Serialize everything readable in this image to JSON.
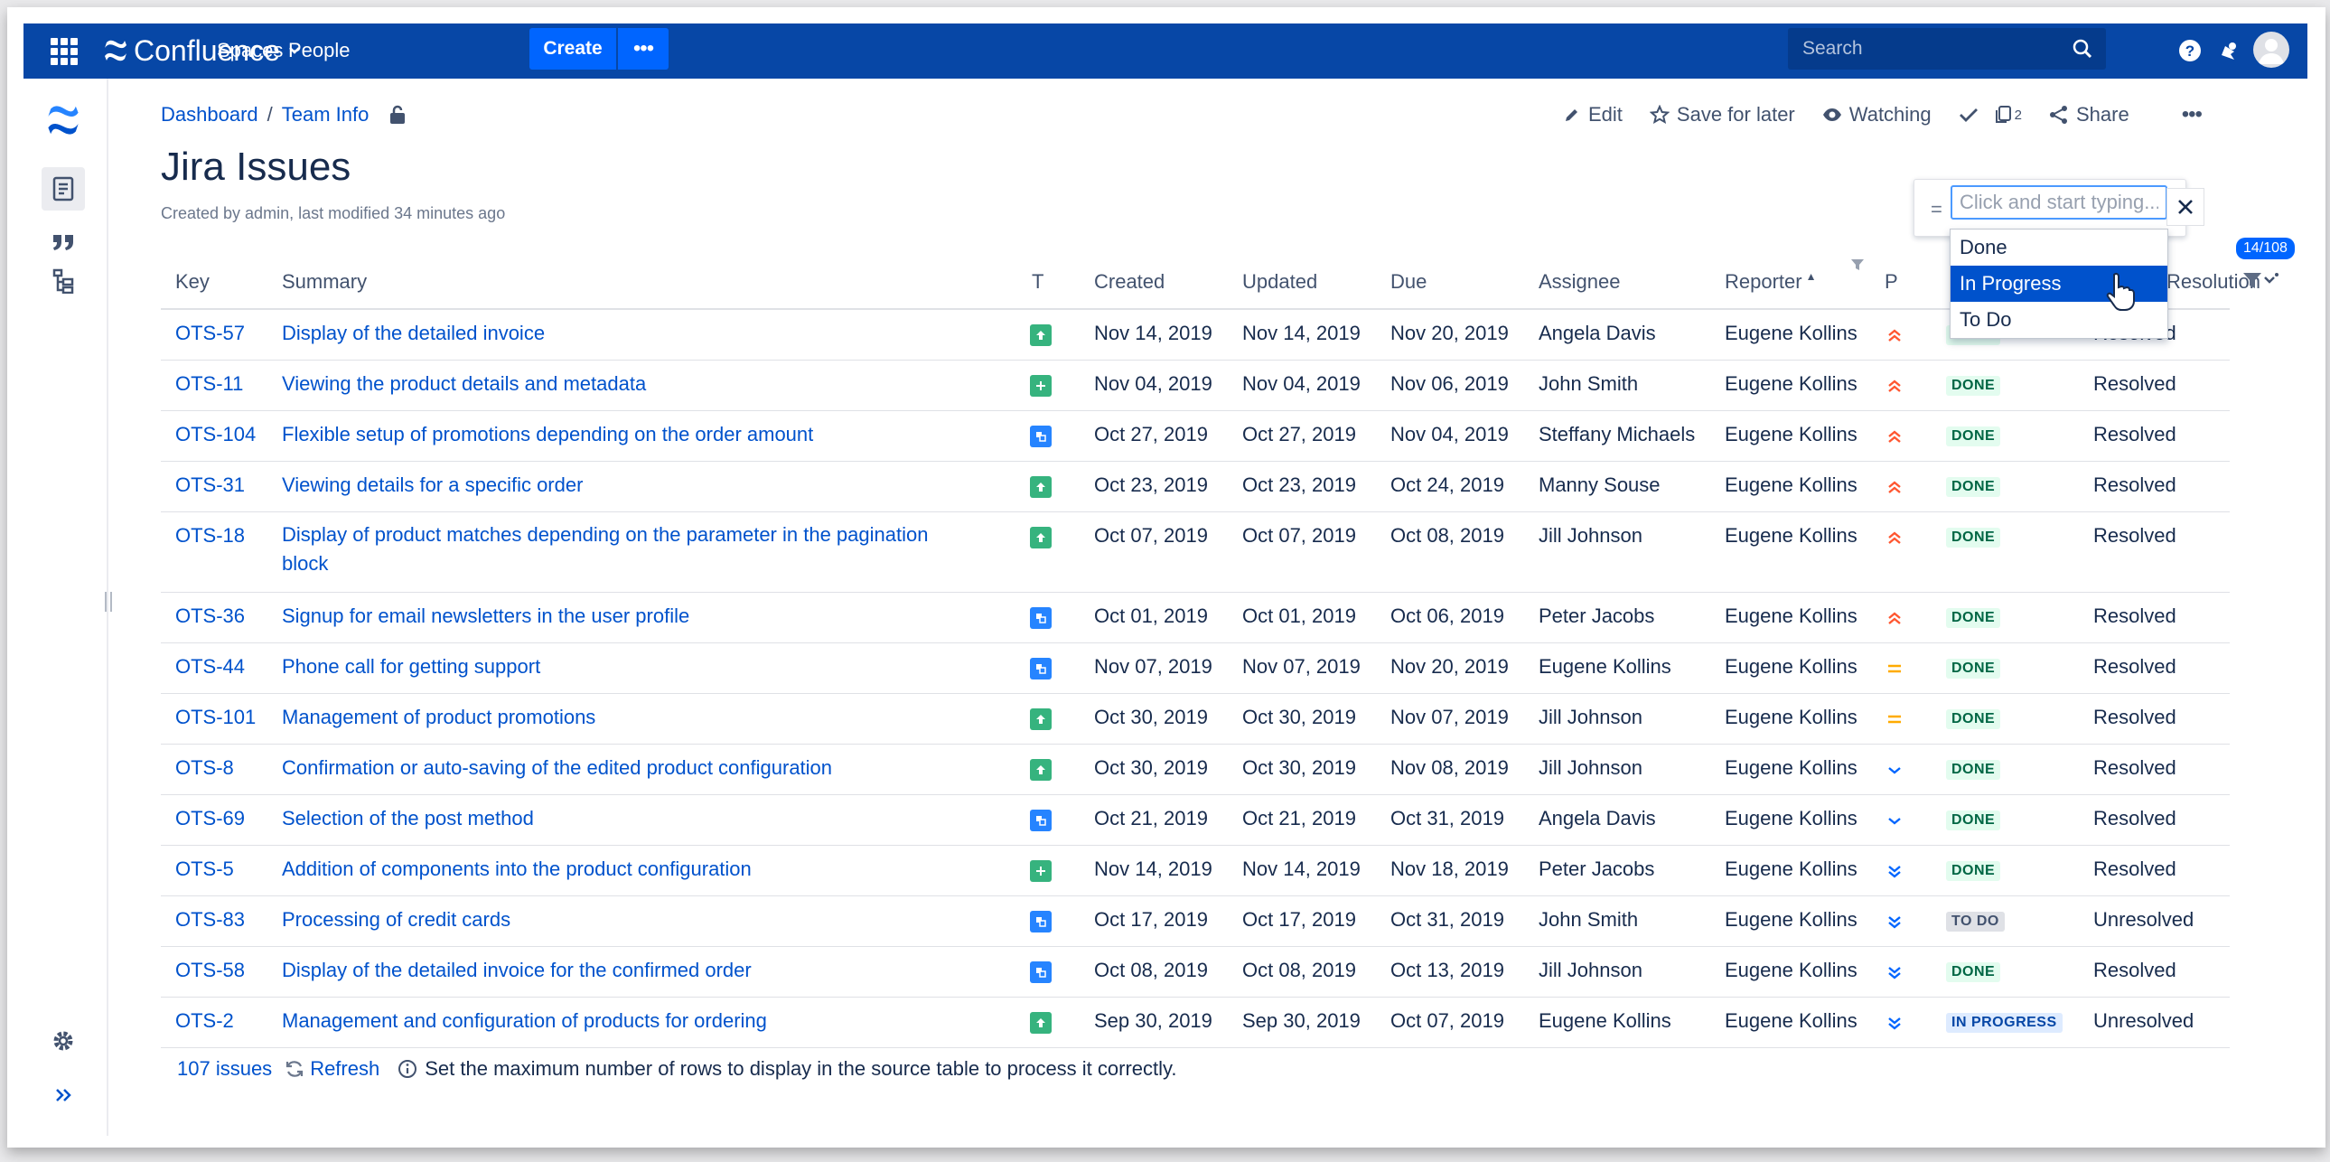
{
  "topbar": {
    "app_name": "Confluence",
    "nav": [
      "Spaces",
      "People"
    ],
    "create_label": "Create",
    "more_label": "•••",
    "search_placeholder": "Search"
  },
  "breadcrumb": [
    "Dashboard",
    "Team Info"
  ],
  "actions": {
    "edit": "Edit",
    "save": "Save for later",
    "watching": "Watching",
    "copies_count": "2",
    "share": "Share"
  },
  "page": {
    "title": "Jira Issues",
    "meta": "Created by admin, last modified 34 minutes ago"
  },
  "table": {
    "columns": [
      "Key",
      "Summary",
      "T",
      "Created",
      "Updated",
      "Due",
      "Assignee",
      "Reporter",
      "P",
      "Resolution"
    ],
    "rows": [
      {
        "key": "OTS-57",
        "summary": "Display of the detailed invoice",
        "type": "story",
        "created": "Nov 14, 2019",
        "updated": "Nov 14, 2019",
        "due": "Nov 20, 2019",
        "assignee": "Angela Davis",
        "reporter": "Eugene Kollins",
        "priority": "high",
        "status": "DONE",
        "resolution": "Resolved"
      },
      {
        "key": "OTS-11",
        "summary": "Viewing the product details and metadata",
        "type": "new-feature",
        "created": "Nov 04, 2019",
        "updated": "Nov 04, 2019",
        "due": "Nov 06, 2019",
        "assignee": "John Smith",
        "reporter": "Eugene Kollins",
        "priority": "high",
        "status": "DONE",
        "resolution": "Resolved"
      },
      {
        "key": "OTS-104",
        "summary": "Flexible setup of promotions depending on the order amount",
        "type": "subtask",
        "created": "Oct 27, 2019",
        "updated": "Oct 27, 2019",
        "due": "Nov 04, 2019",
        "assignee": "Steffany Michaels",
        "reporter": "Eugene Kollins",
        "priority": "high",
        "status": "DONE",
        "resolution": "Resolved"
      },
      {
        "key": "OTS-31",
        "summary": "Viewing details for a specific order",
        "type": "story",
        "created": "Oct 23, 2019",
        "updated": "Oct 23, 2019",
        "due": "Oct 24, 2019",
        "assignee": "Manny Souse",
        "reporter": "Eugene Kollins",
        "priority": "high",
        "status": "DONE",
        "resolution": "Resolved"
      },
      {
        "key": "OTS-18",
        "summary": "Display of product matches depending on the parameter in the pagination block",
        "type": "story",
        "created": "Oct 07, 2019",
        "updated": "Oct 07, 2019",
        "due": "Oct 08, 2019",
        "assignee": "Jill Johnson",
        "reporter": "Eugene Kollins",
        "priority": "high",
        "status": "DONE",
        "resolution": "Resolved"
      },
      {
        "key": "OTS-36",
        "summary": "Signup for email newsletters in the user profile",
        "type": "subtask",
        "created": "Oct 01, 2019",
        "updated": "Oct 01, 2019",
        "due": "Oct 06, 2019",
        "assignee": "Peter Jacobs",
        "reporter": "Eugene Kollins",
        "priority": "high",
        "status": "DONE",
        "resolution": "Resolved"
      },
      {
        "key": "OTS-44",
        "summary": "Phone call for getting support",
        "type": "subtask",
        "created": "Nov 07, 2019",
        "updated": "Nov 07, 2019",
        "due": "Nov 20, 2019",
        "assignee": "Eugene Kollins",
        "reporter": "Eugene Kollins",
        "priority": "medium",
        "status": "DONE",
        "resolution": "Resolved"
      },
      {
        "key": "OTS-101",
        "summary": "Management of product promotions",
        "type": "story",
        "created": "Oct 30, 2019",
        "updated": "Oct 30, 2019",
        "due": "Nov 07, 2019",
        "assignee": "Jill Johnson",
        "reporter": "Eugene Kollins",
        "priority": "medium",
        "status": "DONE",
        "resolution": "Resolved"
      },
      {
        "key": "OTS-8",
        "summary": "Confirmation or auto-saving of the edited product configuration",
        "type": "story",
        "created": "Oct 30, 2019",
        "updated": "Oct 30, 2019",
        "due": "Nov 08, 2019",
        "assignee": "Jill Johnson",
        "reporter": "Eugene Kollins",
        "priority": "low",
        "status": "DONE",
        "resolution": "Resolved"
      },
      {
        "key": "OTS-69",
        "summary": "Selection of the post method",
        "type": "subtask",
        "created": "Oct 21, 2019",
        "updated": "Oct 21, 2019",
        "due": "Oct 31, 2019",
        "assignee": "Angela Davis",
        "reporter": "Eugene Kollins",
        "priority": "low",
        "status": "DONE",
        "resolution": "Resolved"
      },
      {
        "key": "OTS-5",
        "summary": "Addition of components into the product configuration",
        "type": "new-feature",
        "created": "Nov 14, 2019",
        "updated": "Nov 14, 2019",
        "due": "Nov 18, 2019",
        "assignee": "Peter Jacobs",
        "reporter": "Eugene Kollins",
        "priority": "lowest",
        "status": "DONE",
        "resolution": "Resolved"
      },
      {
        "key": "OTS-83",
        "summary": "Processing of credit cards",
        "type": "subtask",
        "created": "Oct 17, 2019",
        "updated": "Oct 17, 2019",
        "due": "Oct 31, 2019",
        "assignee": "John Smith",
        "reporter": "Eugene Kollins",
        "priority": "lowest",
        "status": "TO DO",
        "resolution": "Unresolved"
      },
      {
        "key": "OTS-58",
        "summary": "Display of the detailed invoice for the confirmed order",
        "type": "subtask",
        "created": "Oct 08, 2019",
        "updated": "Oct 08, 2019",
        "due": "Oct 13, 2019",
        "assignee": "Jill Johnson",
        "reporter": "Eugene Kollins",
        "priority": "lowest",
        "status": "DONE",
        "resolution": "Resolved"
      },
      {
        "key": "OTS-2",
        "summary": "Management and configuration of products for ordering",
        "type": "story",
        "created": "Sep 30, 2019",
        "updated": "Sep 30, 2019",
        "due": "Oct 07, 2019",
        "assignee": "Eugene Kollins",
        "reporter": "Eugene Kollins",
        "priority": "lowest",
        "status": "IN PROGRESS",
        "resolution": "Unresolved"
      }
    ]
  },
  "footer": {
    "count": "107 issues",
    "refresh": "Refresh",
    "note": "Set the maximum number of rows to display in the source table to process it correctly."
  },
  "filter": {
    "operator": "=",
    "placeholder": "Click and start typing...",
    "options": [
      "Done",
      "In Progress",
      "To Do"
    ],
    "selected": "In Progress",
    "badge": "14/108"
  },
  "colors": {
    "nav": "#0747a6",
    "link": "#0052cc",
    "high": "#ff5630",
    "medium": "#ffab00",
    "low": "#0065ff"
  }
}
